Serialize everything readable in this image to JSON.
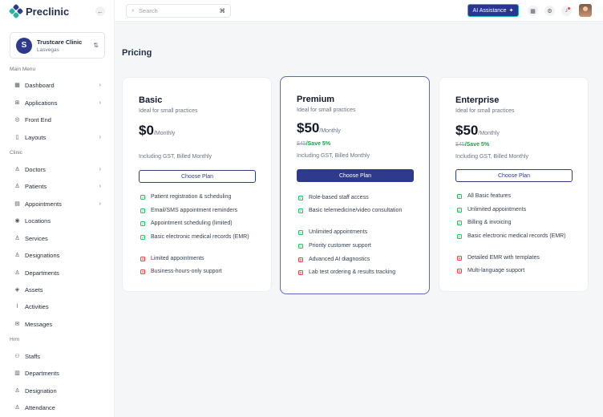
{
  "brand": {
    "name": "Preclinic"
  },
  "clinic": {
    "name": "Trustcare Clinic",
    "location": "Lasvegas"
  },
  "sections": {
    "main": "Main Menu",
    "clinic": "Clinic",
    "hrm": "Hrm"
  },
  "nav": {
    "dashboard": "Dashboard",
    "applications": "Applications",
    "frontend": "Front End",
    "layouts": "Layouts",
    "doctors": "Doctors",
    "patients": "Patients",
    "appointments": "Appointments",
    "locations": "Locations",
    "services": "Services",
    "designations": "Designations",
    "departments": "Departments",
    "assets": "Assets",
    "activities": "Activities",
    "messages": "Messages",
    "staffs": "Staffs",
    "hrm_departments": "Departments",
    "designation": "Designation",
    "attendance": "Attendance"
  },
  "search": {
    "placeholder": "Search",
    "shortcut": "⌘"
  },
  "topbar": {
    "ai_label": "AI Assistance"
  },
  "page": {
    "title": "Pricing"
  },
  "plans": [
    {
      "name": "Basic",
      "desc": "Ideal for small practices",
      "price": "$0",
      "period": "/Monthly",
      "gst": "Including GST, Billed Monthly",
      "button": "Choose Plan",
      "features": [
        "Patient registration & scheduling",
        "Email/SMS appointment reminders",
        "Appointment scheduling (limited)",
        "Basic electronic medical records (EMR)",
        "Limited appointments",
        "Business-hours-only support"
      ]
    },
    {
      "name": "Premium",
      "desc": "Ideal for small practices",
      "price": "$50",
      "period": "/Monthly",
      "old_price": "$45",
      "save": "/Save 5%",
      "gst": "Including GST, Billed Monthly",
      "button": "Choose Plan",
      "features": [
        "Role-based staff access",
        "Basic telemedicine/video consultation",
        "Unlimited appointments",
        "Priority customer support",
        "Advanced AI diagnostics",
        "Lab test ordering & results tracking"
      ]
    },
    {
      "name": "Enterprise",
      "desc": "Ideal for small practices",
      "price": "$50",
      "period": "/Monthly",
      "old_price": "$45",
      "save": "/Save 5%",
      "gst": "Including GST, Billed Monthly",
      "button": "Choose Plan",
      "features": [
        "All Basic features",
        "Unlimited appointments",
        "Billing & invoicing",
        "Basic electronic medical records (EMR)",
        "Detailed EMR with templates",
        "Multi-language support"
      ]
    }
  ],
  "colors": {
    "brand": "#2e3a8c",
    "yes": "#22c55e",
    "no": "#ef4444"
  }
}
